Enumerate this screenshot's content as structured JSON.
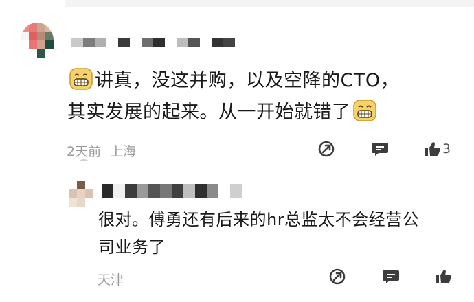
{
  "comment": {
    "text_line1_before_emoji": "",
    "text_line1": "讲真，没这并购，以及空降的CTO，",
    "text_line2": "其实发展的起来。从一开始就错了",
    "time": "2天前",
    "location": "上海",
    "like_count": "3",
    "emoji_icon": "grin-emoji-icon",
    "avatar_colors": [
      "#f08a8a",
      "#e87a7a",
      "#caa58f",
      "#d9b7a6",
      "#f4f4f4",
      "#e06060",
      "#b58c77",
      "#6b7a63",
      "#ffffff",
      "#e97474",
      "#d0a08e",
      "#1f4d3f",
      "#ffffff",
      "#ffffff",
      "#2c5848",
      "#ffffff"
    ],
    "name_blocks": [
      "#c9c9c9",
      "#7d7d7d",
      "#b0b0b0",
      "#ffffff",
      "#3a3a3a",
      "#ffffff",
      "#6e6e6e",
      "#2e2e2e",
      "#ffffff",
      "#bdbdbd",
      "#555555",
      "#ffffff",
      "#333333",
      "#444444"
    ]
  },
  "reply": {
    "text_line1": "很对。傅勇还有后来的hr总监太不会经营公",
    "text_line2": "司业务了",
    "location": "天津",
    "avatar_colors": [
      "#ffffff",
      "#7a5b48",
      "#ffffff",
      "#d8c3b3",
      "#e8d2c2",
      "#d9c4b4",
      "#efe2d6",
      "#e9d8ca",
      "#ffffff"
    ],
    "name_blocks": [
      "#2a2a2a",
      "#f0f0f0",
      "#3c3c3c",
      "#9a9a9a",
      "#555555",
      "#777777",
      "#404040",
      "#bfbfbf",
      "#2f2f2f",
      "#8a8a8a",
      "#ffffff",
      "#cfcfcf"
    ]
  },
  "icons": {
    "share": "share-icon",
    "reply": "comment-icon",
    "like": "thumbs-up-icon"
  },
  "colors": {
    "text": "#1a1a1a",
    "meta": "#9a9a9a",
    "icon": "#3d3d3d",
    "emoji_fill": "#f5d36a",
    "emoji_outline": "#c99a2e"
  }
}
